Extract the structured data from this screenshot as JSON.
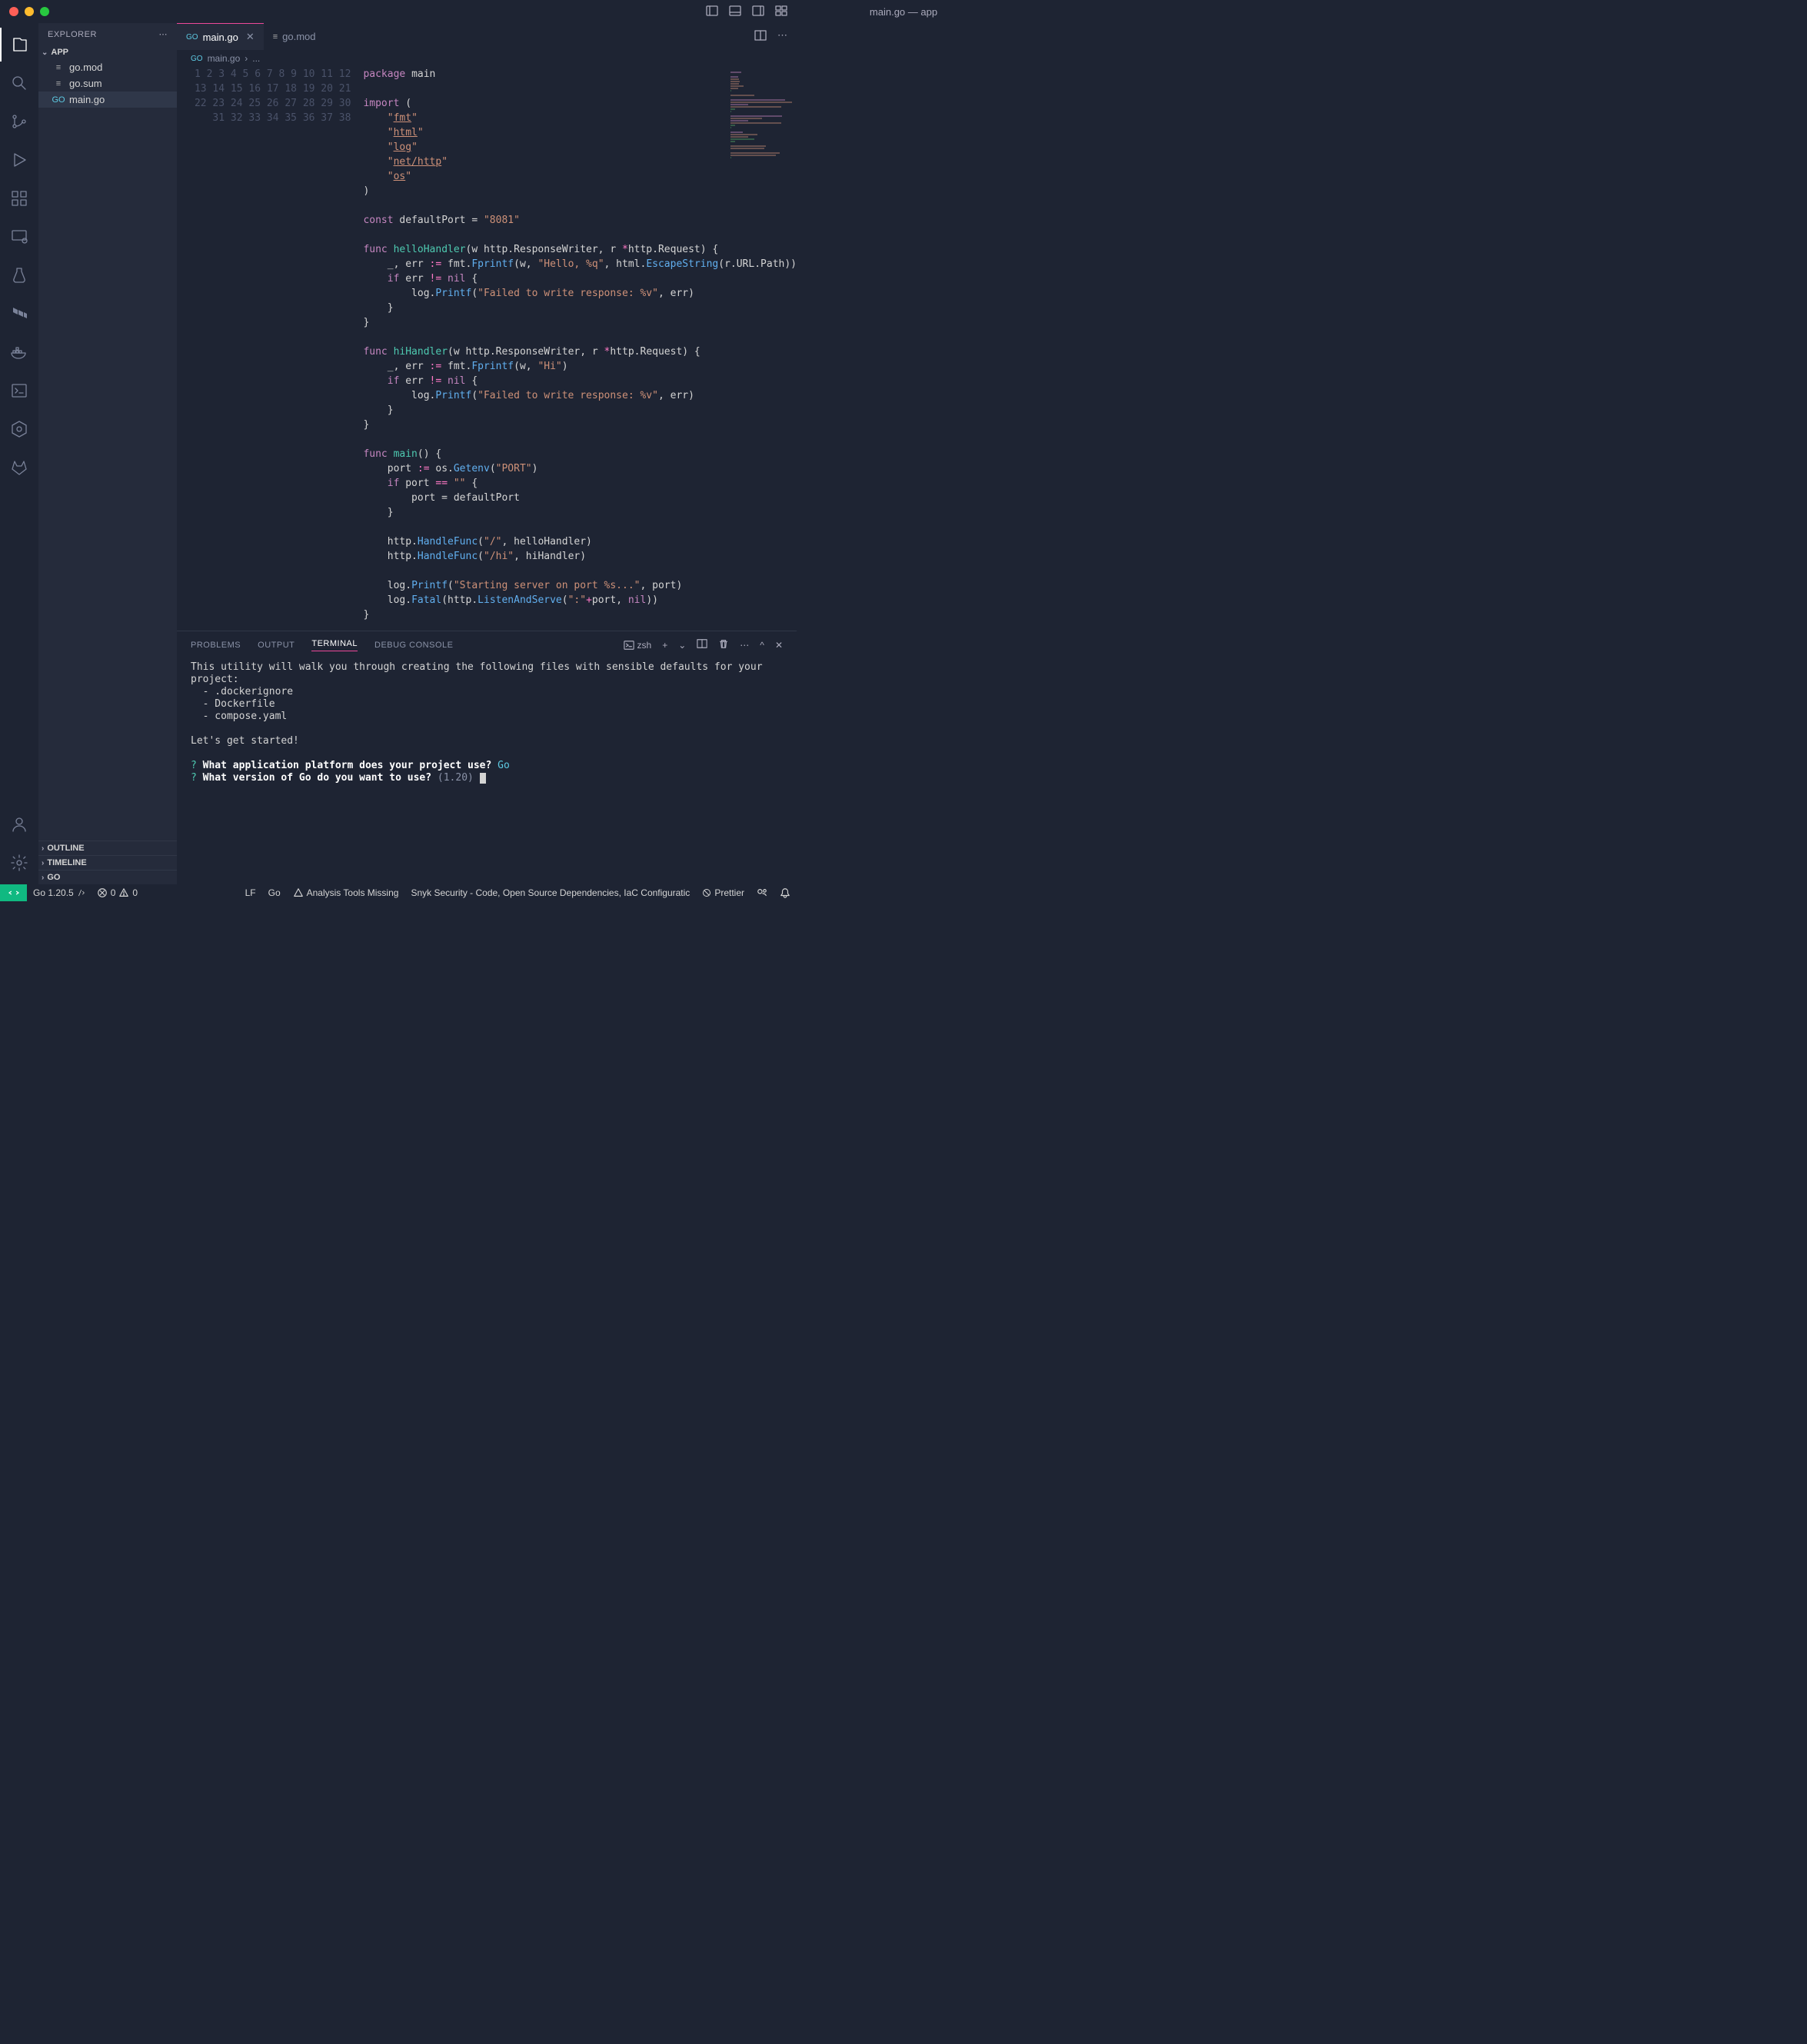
{
  "window": {
    "title": "main.go — app"
  },
  "explorer": {
    "title": "EXPLORER",
    "folder": "APP",
    "files": [
      {
        "name": "go.mod",
        "icon": "text"
      },
      {
        "name": "go.sum",
        "icon": "text"
      },
      {
        "name": "main.go",
        "icon": "go",
        "active": true
      }
    ],
    "sections": [
      "OUTLINE",
      "TIMELINE",
      "GO"
    ]
  },
  "tabs": [
    {
      "name": "main.go",
      "icon": "go",
      "active": true,
      "dirty": false,
      "closable": true
    },
    {
      "name": "go.mod",
      "icon": "text",
      "active": false
    }
  ],
  "breadcrumb": [
    "main.go",
    "..."
  ],
  "code_lines": [
    {
      "n": 1,
      "h": "<span class='kw'>package</span> <span class='pkg'>main</span>"
    },
    {
      "n": 2,
      "h": ""
    },
    {
      "n": 3,
      "h": "<span class='kw'>import</span> ("
    },
    {
      "n": 4,
      "h": "    <span class='str'>\"<u>fmt</u>\"</span>"
    },
    {
      "n": 5,
      "h": "    <span class='str'>\"<u>html</u>\"</span>"
    },
    {
      "n": 6,
      "h": "    <span class='str'>\"<u>log</u>\"</span>"
    },
    {
      "n": 7,
      "h": "    <span class='str'>\"<u>net/http</u>\"</span>"
    },
    {
      "n": 8,
      "h": "    <span class='str'>\"<u>os</u>\"</span>"
    },
    {
      "n": 9,
      "h": ")"
    },
    {
      "n": 10,
      "h": ""
    },
    {
      "n": 11,
      "h": "<span class='kw'>const</span> defaultPort = <span class='str'>\"8081\"</span>"
    },
    {
      "n": 12,
      "h": ""
    },
    {
      "n": 13,
      "h": "<span class='kw'>func</span> <span class='fn'>helloHandler</span>(w http.ResponseWriter, r <span class='op'>*</span>http.Request) {"
    },
    {
      "n": 14,
      "h": "    _, err <span class='op'>:=</span> fmt.<span class='call'>Fprintf</span>(w, <span class='str'>\"Hello, %q\"</span>, html.<span class='call'>EscapeString</span>(r.URL.Path))"
    },
    {
      "n": 15,
      "h": "    <span class='kw'>if</span> err <span class='op'>!=</span> <span class='nil'>nil</span> {"
    },
    {
      "n": 16,
      "h": "        log.<span class='call'>Printf</span>(<span class='str'>\"Failed to write response: %v\"</span>, err)"
    },
    {
      "n": 17,
      "h": "    }"
    },
    {
      "n": 18,
      "h": "}"
    },
    {
      "n": 19,
      "h": ""
    },
    {
      "n": 20,
      "h": "<span class='kw'>func</span> <span class='fn'>hiHandler</span>(w http.ResponseWriter, r <span class='op'>*</span>http.Request) {"
    },
    {
      "n": 21,
      "h": "    _, err <span class='op'>:=</span> fmt.<span class='call'>Fprintf</span>(w, <span class='str'>\"Hi\"</span>)"
    },
    {
      "n": 22,
      "h": "    <span class='kw'>if</span> err <span class='op'>!=</span> <span class='nil'>nil</span> {"
    },
    {
      "n": 23,
      "h": "        log.<span class='call'>Printf</span>(<span class='str'>\"Failed to write response: %v\"</span>, err)"
    },
    {
      "n": 24,
      "h": "    }"
    },
    {
      "n": 25,
      "h": "}"
    },
    {
      "n": 26,
      "h": ""
    },
    {
      "n": 27,
      "h": "<span class='kw'>func</span> <span class='fn'>main</span>() {"
    },
    {
      "n": 28,
      "h": "    port <span class='op'>:=</span> os.<span class='call'>Getenv</span>(<span class='str'>\"PORT\"</span>)"
    },
    {
      "n": 29,
      "h": "    <span class='kw'>if</span> port <span class='op'>==</span> <span class='str'>\"\"</span> {"
    },
    {
      "n": 30,
      "h": "        port = defaultPort"
    },
    {
      "n": 31,
      "h": "    }"
    },
    {
      "n": 32,
      "h": ""
    },
    {
      "n": 33,
      "h": "    http.<span class='call'>HandleFunc</span>(<span class='str'>\"/\"</span>, helloHandler)"
    },
    {
      "n": 34,
      "h": "    http.<span class='call'>HandleFunc</span>(<span class='str'>\"/hi\"</span>, hiHandler)"
    },
    {
      "n": 35,
      "h": ""
    },
    {
      "n": 36,
      "h": "    log.<span class='call'>Printf</span>(<span class='str'>\"Starting server on port %s...\"</span>, port)"
    },
    {
      "n": 37,
      "h": "    log.<span class='call'>Fatal</span>(http.<span class='call'>ListenAndServe</span>(<span class='str'>\":\"</span><span class='op'>+</span>port, <span class='nil'>nil</span>))"
    },
    {
      "n": 38,
      "h": "}"
    }
  ],
  "panel": {
    "tabs": [
      "PROBLEMS",
      "OUTPUT",
      "TERMINAL",
      "DEBUG CONSOLE"
    ],
    "active_tab": "TERMINAL",
    "terminal_shell": "zsh",
    "terminal_lines": [
      "This utility will walk you through creating the following files with sensible defaults for your project:",
      "  - .dockerignore",
      "  - Dockerfile",
      "  - compose.yaml",
      "",
      "Let's get started!",
      ""
    ],
    "terminal_prompts": [
      {
        "q": "What application platform does your project use?",
        "a": "Go"
      },
      {
        "q": "What version of Go do you want to use?",
        "hint": "(1.20)",
        "cursor": true
      }
    ]
  },
  "statusbar": {
    "go_version": "Go 1.20.5",
    "errors": "0",
    "warnings": "0",
    "eol": "LF",
    "lang": "Go",
    "analysis": "Analysis Tools Missing",
    "snyk": "Snyk Security - Code, Open Source Dependencies, IaC Configuratic",
    "prettier": "Prettier"
  }
}
